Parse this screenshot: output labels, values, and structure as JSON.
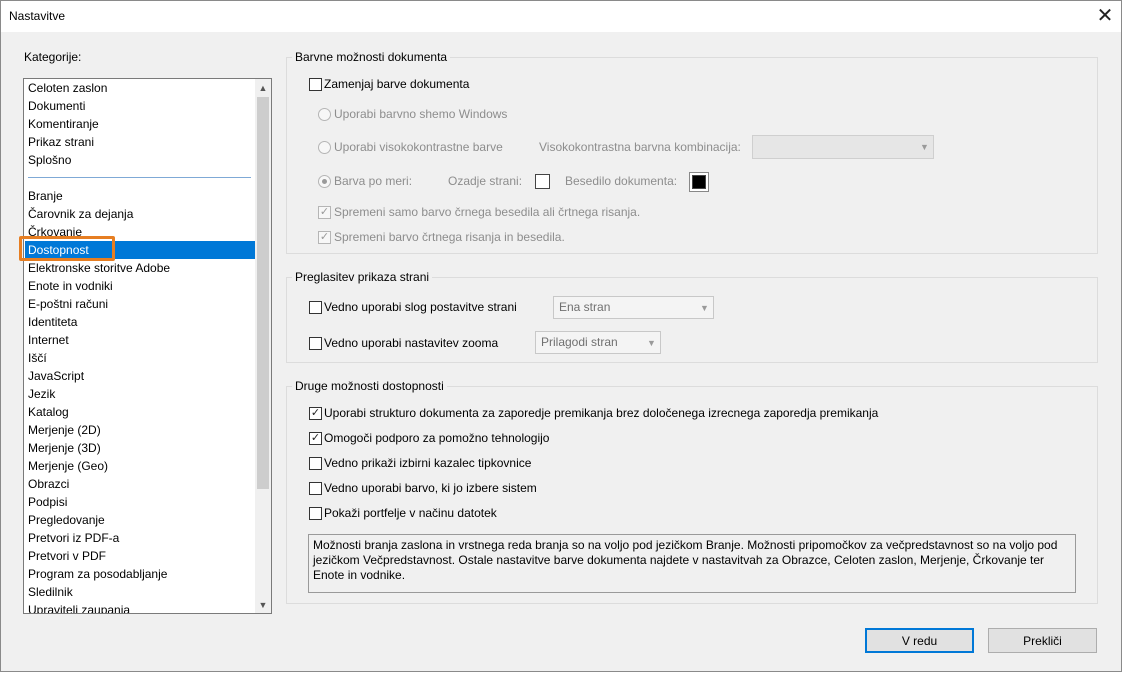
{
  "window": {
    "title": "Nastavitve"
  },
  "categories": {
    "label": "Kategorije:",
    "top_items": [
      "Celoten zaslon",
      "Dokumenti",
      "Komentiranje",
      "Prikaz strani",
      "Splošno"
    ],
    "items": [
      "Branje",
      "Čarovnik za dejanja",
      "Črkovanje",
      "Dostopnost",
      "Elektronske storitve Adobe",
      "Enote in vodniki",
      "E-poštni računi",
      "Identiteta",
      "Internet",
      "Iščí",
      "JavaScript",
      "Jezik",
      "Katalog",
      "Merjenje (2D)",
      "Merjenje (3D)",
      "Merjenje (Geo)",
      "Obrazci",
      "Podpisi",
      "Pregledovanje",
      "Pretvori iz PDF-a",
      "Pretvori v PDF",
      "Program za posodabljanje",
      "Sledilnik",
      "Upravitelj zaupanja"
    ],
    "selected": "Dostopnost"
  },
  "colors": {
    "selection": "#0078d7",
    "highlight_outline": "#e67e22",
    "primary_border": "#0078d7"
  },
  "doc_colors": {
    "title": "Barvne možnosti dokumenta",
    "replace_label": "Zamenjaj barve dokumenta",
    "replace_checked": false,
    "windows_scheme": "Uporabi barvno shemo Windows",
    "high_contrast": "Uporabi visokokontrastne barve",
    "hc_combo_label": "Visokokontrastna barvna kombinacija:",
    "hc_combo_value": "",
    "custom": "Barva po meri:",
    "page_bg_label": "Ozadje strani:",
    "page_bg_color": "#ffffff",
    "text_label": "Besedilo dokumenta:",
    "text_color": "#000000",
    "only_black": "Spremeni samo barvo črnega besedila ali črtnega risanja.",
    "line_art": "Spremeni barvo črtnega risanja in besedila."
  },
  "page_display": {
    "title": "Preglasitev prikaza strani",
    "layout_label": "Vedno uporabi slog postavitve strani",
    "layout_value": "Ena stran",
    "zoom_label": "Vedno uporabi nastavitev zooma",
    "zoom_value": "Prilagodi stran"
  },
  "other": {
    "title": "Druge možnosti dostopnosti",
    "options": [
      {
        "label": "Uporabi strukturo dokumenta za zaporedje premikanja brez določenega izrecnega zaporedja premikanja",
        "checked": true
      },
      {
        "label": "Omogoči podporo za pomožno tehnologijo",
        "checked": true
      },
      {
        "label": "Vedno prikaži izbirni kazalec tipkovnice",
        "checked": false
      },
      {
        "label": "Vedno uporabi barvo, ki jo izbere sistem",
        "checked": false
      },
      {
        "label": "Pokaži portfelje v načinu datotek",
        "checked": false
      }
    ],
    "info": "Možnosti branja zaslona in vrstnega reda branja so na voljo pod jezičkom Branje. Možnosti pripomočkov za večpredstavnost so na voljo pod jezičkom Večpredstavnost. Ostale nastavitve barve dokumenta najdete v nastavitvah za Obrazce, Celoten zaslon, Merjenje, Črkovanje ter Enote in vodnike."
  },
  "buttons": {
    "ok": "V redu",
    "cancel": "Prekliči"
  }
}
